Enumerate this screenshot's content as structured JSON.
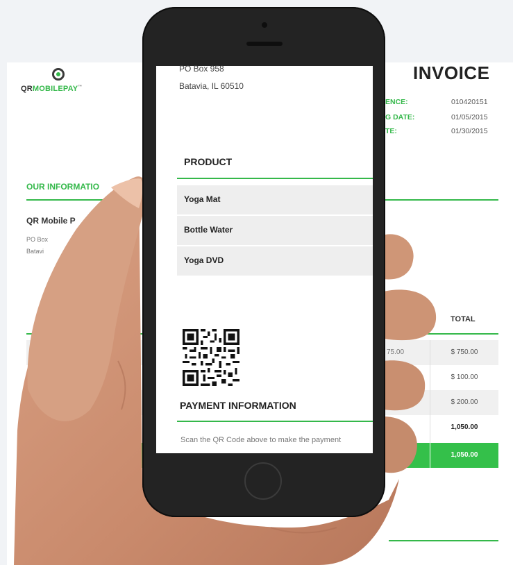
{
  "invoice": {
    "brand_prefix": "QR",
    "brand_suffix": "MOBILEPAY",
    "brand_tm": "™",
    "title": "INVOICE",
    "meta": [
      {
        "label": "ENCE:",
        "value": "010420151"
      },
      {
        "label": "G DATE:",
        "value": "01/05/2015"
      },
      {
        "label": "TE:",
        "value": "01/30/2015"
      }
    ],
    "our_information": "OUR INFORMATIO",
    "company": "QR Mobile P",
    "addr1": "PO Box",
    "addr2": "Batavi",
    "total_header": "TOTAL",
    "partial_price": "75.00",
    "rows": [
      "$ 750.00",
      "$ 100.00",
      "$ 200.00"
    ],
    "subtotal": "1,050.00",
    "grand_total": "1,050.00"
  },
  "phone_screen": {
    "address_line1": "PO Box 958",
    "address_line2": "Batavia, IL 60510",
    "product_header": "PRODUCT",
    "products": [
      "Yoga Mat",
      "Bottle Water",
      "Yoga DVD"
    ],
    "payment_header": "PAYMENT INFORMATION",
    "payment_note": "Scan the QR Code above to make the payment"
  },
  "colors": {
    "accent_green": "#34b84a",
    "phone_body": "#232323",
    "background": "#f1f3f6"
  },
  "icons": [
    "qrmobilepay-logo-icon",
    "qr-code-icon",
    "home-button-icon"
  ]
}
